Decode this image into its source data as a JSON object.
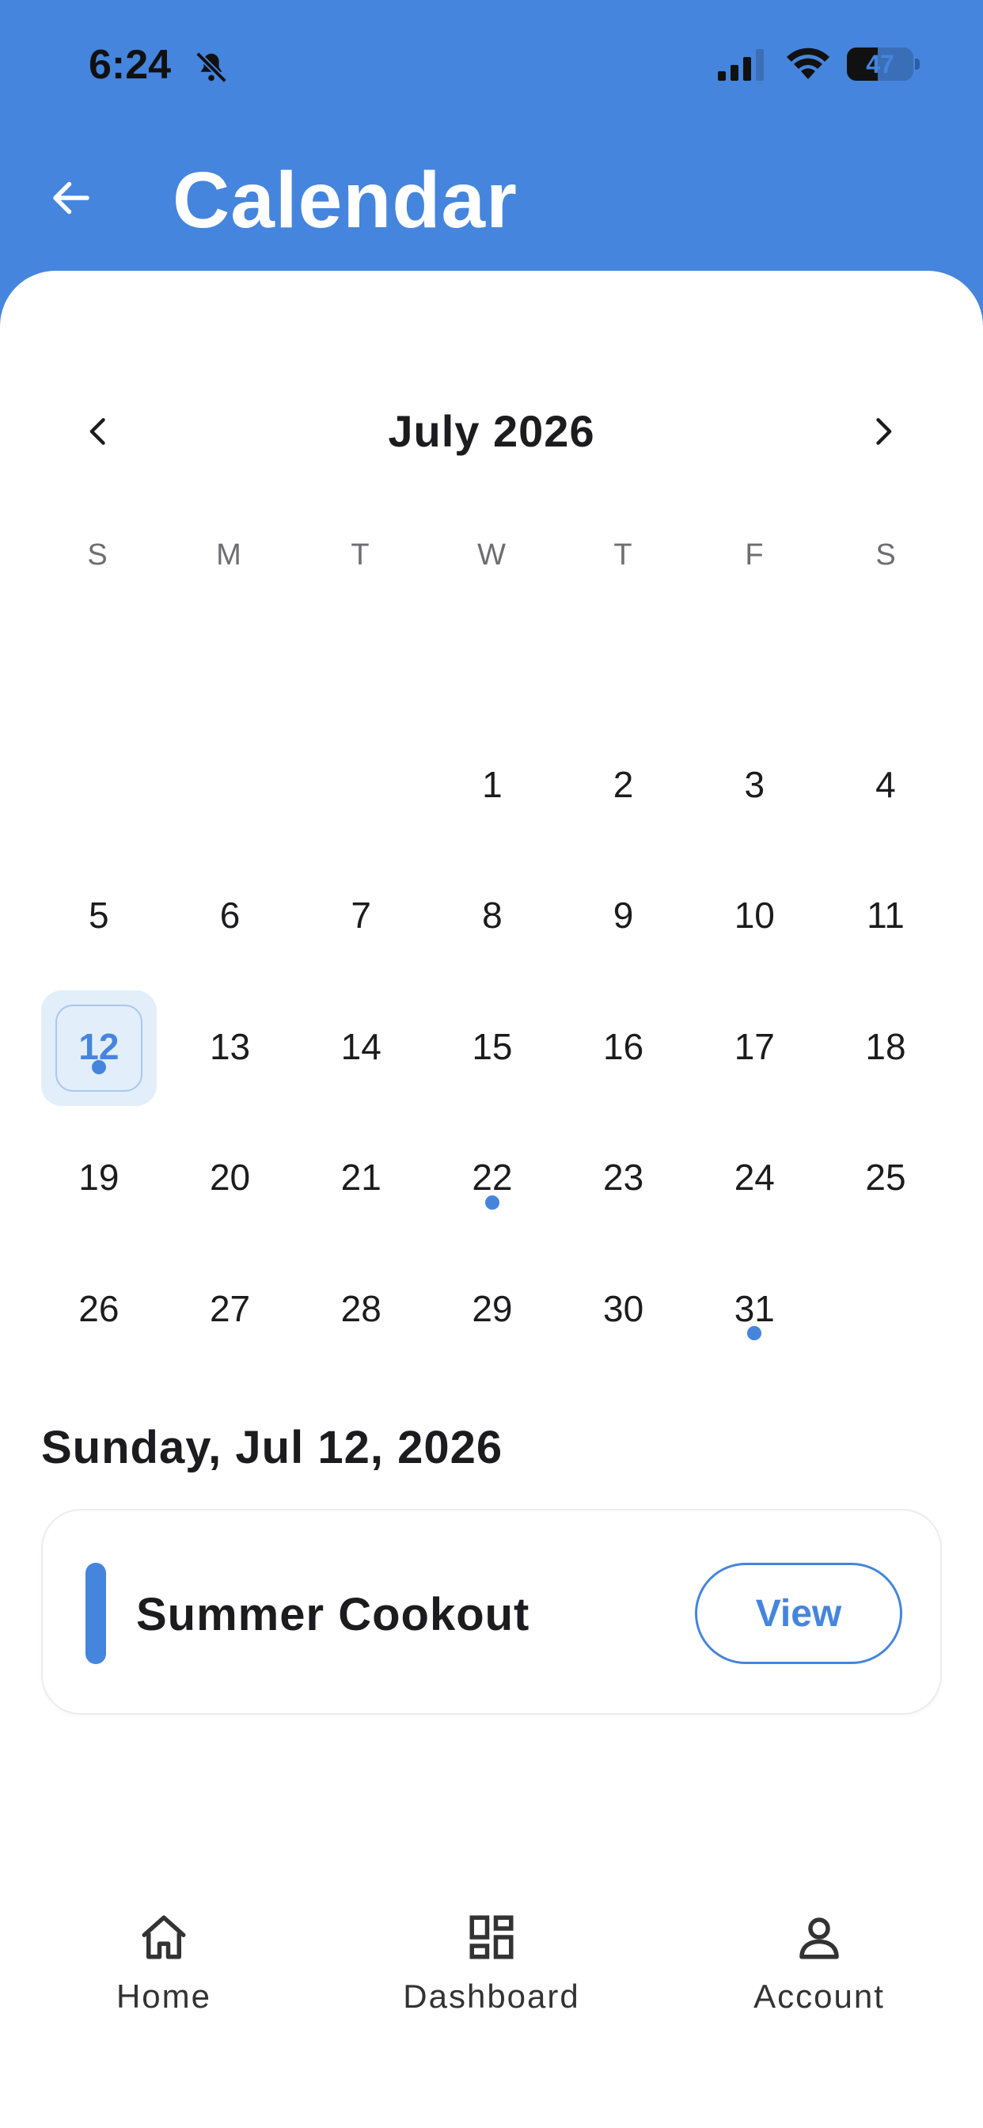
{
  "status_bar": {
    "time": "6:24",
    "battery_level": "47",
    "battery_fraction": 0.47
  },
  "header": {
    "title": "Calendar",
    "back_icon": "arrow-left-icon",
    "background_color": "#4585DD"
  },
  "calendar": {
    "month_label": "July 2026",
    "prev_icon": "chevron-left-icon",
    "next_icon": "chevron-right-icon",
    "weekdays": [
      "S",
      "M",
      "T",
      "W",
      "T",
      "F",
      "S"
    ],
    "leading_blank_days": 3,
    "days": [
      "1",
      "2",
      "3",
      "4",
      "5",
      "6",
      "7",
      "8",
      "9",
      "10",
      "11",
      "12",
      "13",
      "14",
      "15",
      "16",
      "17",
      "18",
      "19",
      "20",
      "21",
      "22",
      "23",
      "24",
      "25",
      "26",
      "27",
      "28",
      "29",
      "30",
      "31"
    ],
    "selected_day": "12",
    "event_days": [
      "12",
      "22",
      "31"
    ],
    "accent_color": "#4585DD"
  },
  "selected_date": {
    "label": "Sunday, Jul 12, 2026"
  },
  "events": [
    {
      "title": "Summer Cookout",
      "action_label": "View"
    }
  ],
  "bottom_nav": {
    "items": [
      {
        "label": "Home",
        "icon": "home-icon"
      },
      {
        "label": "Dashboard",
        "icon": "dashboard-icon"
      },
      {
        "label": "Account",
        "icon": "account-icon"
      }
    ]
  }
}
